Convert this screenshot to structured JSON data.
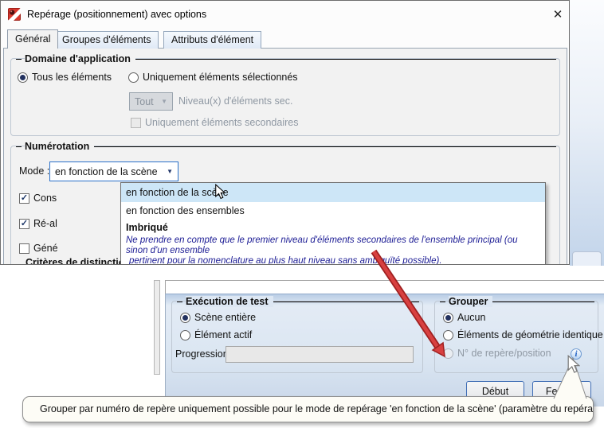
{
  "window": {
    "title": "Repérage (positionnement) avec options",
    "close_glyph": "✕",
    "tabs": [
      "Général",
      "Groupes d'éléments",
      "Attributs d'élément"
    ]
  },
  "domaine": {
    "title": "Domaine d'application",
    "radio_tous": "Tous les éléments",
    "radio_uniquement": "Uniquement éléments sélectionnés",
    "combo_value": "Tout",
    "combo_arrow": "▼",
    "niveau_label": "Niveau(x) d'éléments sec.",
    "check_secondaires": "Uniquement éléments secondaires"
  },
  "numerotation": {
    "title": "Numérotation",
    "mode_label": "Mode :",
    "mode_value": "en fonction de la scène",
    "mode_arrow": "▼",
    "checks": [
      "Cons",
      "Ré-al",
      "Géné"
    ],
    "cut_group_title": "Critères de distinction de la"
  },
  "mode_dropdown": {
    "items": [
      "en fonction de la scène",
      "en fonction des ensembles",
      "Imbriqué"
    ],
    "note_line1": "Ne prendre en compte que le premier niveau d'éléments secondaires de l'ensemble principal (ou sinon d'un ensemble",
    "note_line2": "pertinent pour la nomenclature au plus haut niveau sans ambiguïté possible)."
  },
  "test_panel": {
    "execution": {
      "title": "Exécution de test",
      "radio_scene": "Scène entière",
      "radio_element": "Élément actif",
      "progression_label": "Progression:"
    },
    "grouper": {
      "title": "Grouper",
      "radio_aucun": "Aucun",
      "radio_geometrie": "Éléments de géométrie identique",
      "radio_repere": "N° de repère/position",
      "info_glyph": "i"
    },
    "buttons": {
      "debut": "Début",
      "fermer": "Fermer"
    }
  },
  "tooltip": {
    "text": "Grouper par numéro de repère uniquement possible pour le mode de repérage 'en fonction de la scène' (paramètre du repérage)"
  },
  "colors": {
    "highlight_row": "#cde6f7",
    "note_text": "#1b1b94",
    "arrow_red": "#d84040",
    "focus_border": "#2a70c8"
  }
}
